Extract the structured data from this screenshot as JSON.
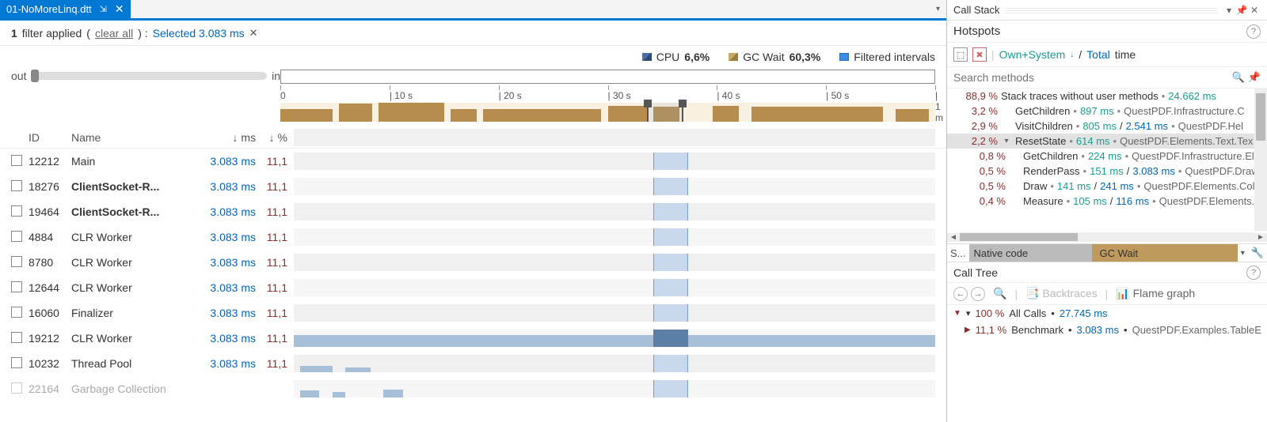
{
  "tab": {
    "title": "01-NoMoreLinq.dtt"
  },
  "filter": {
    "count": "1",
    "applied_text": "filter applied",
    "clear": "clear all",
    "selected": "Selected 3.083 ms"
  },
  "metrics": {
    "cpu_label": "CPU",
    "cpu_value": "6,6%",
    "gc_label": "GC Wait",
    "gc_value": "60,3%",
    "filtered_label": "Filtered intervals"
  },
  "zoom": {
    "out": "out",
    "in": "in"
  },
  "ruler": [
    "0",
    "10 s",
    "20 s",
    "30 s",
    "40 s",
    "50 s",
    "1 m"
  ],
  "thread_header": {
    "id": "ID",
    "name": "Name",
    "ms": "↓ ms",
    "pct": "↓ %"
  },
  "threads": [
    {
      "id": "12212",
      "name": "Main",
      "ms": "3.083 ms",
      "pct": "11,1",
      "bold": false
    },
    {
      "id": "18276",
      "name": "ClientSocket-R...",
      "ms": "3.083 ms",
      "pct": "11,1",
      "bold": true
    },
    {
      "id": "19464",
      "name": "ClientSocket-R...",
      "ms": "3.083 ms",
      "pct": "11,1",
      "bold": true
    },
    {
      "id": "4884",
      "name": "CLR Worker",
      "ms": "3.083 ms",
      "pct": "11,1",
      "bold": false
    },
    {
      "id": "8780",
      "name": "CLR Worker",
      "ms": "3.083 ms",
      "pct": "11,1",
      "bold": false
    },
    {
      "id": "12644",
      "name": "CLR Worker",
      "ms": "3.083 ms",
      "pct": "11,1",
      "bold": false
    },
    {
      "id": "16060",
      "name": "Finalizer",
      "ms": "3.083 ms",
      "pct": "11,1",
      "bold": false
    },
    {
      "id": "19212",
      "name": "CLR Worker",
      "ms": "3.083 ms",
      "pct": "11,1",
      "bold": false,
      "heavy": true
    },
    {
      "id": "10232",
      "name": "Thread Pool",
      "ms": "3.083 ms",
      "pct": "11,1",
      "bold": false
    },
    {
      "id": "22164",
      "name": "Garbage Collection",
      "ms": "",
      "pct": "",
      "bold": false,
      "dim": true
    }
  ],
  "selection": {
    "left_pct": 56.0,
    "width_pct": 5.5
  },
  "callstack": {
    "title": "Call Stack",
    "hotspots_title": "Hotspots",
    "own_system": "Own+System",
    "total": "Total",
    "time": "time",
    "search_placeholder": "Search methods"
  },
  "hotspots": [
    {
      "pct": "88,9 %",
      "name": "Stack traces without user methods",
      "own": "24.662 ms",
      "tot": "",
      "ns": "",
      "top": true
    },
    {
      "pct": "3,2 %",
      "name": "GetChildren",
      "own": "897 ms",
      "tot": "",
      "ns": "QuestPDF.Infrastructure.C"
    },
    {
      "pct": "2,9 %",
      "name": "VisitChildren",
      "own": "805 ms",
      "tot": "2.541 ms",
      "ns": "QuestPDF.Hel"
    },
    {
      "pct": "2,2 %",
      "name": "ResetState",
      "own": "614 ms",
      "tot": "",
      "ns": "QuestPDF.Elements.Text.Tex",
      "sel": true,
      "exp": true
    },
    {
      "pct": "0,8 %",
      "name": "GetChildren",
      "own": "224 ms",
      "tot": "",
      "ns": "QuestPDF.Infrastructure.El",
      "child": true
    },
    {
      "pct": "0,5 %",
      "name": "RenderPass",
      "own": "151 ms",
      "tot": "3.083 ms",
      "ns": "QuestPDF.Drawi",
      "child": true
    },
    {
      "pct": "0,5 %",
      "name": "Draw",
      "own": "141 ms",
      "tot": "241 ms",
      "ns": "QuestPDF.Elements.Colu",
      "child": true
    },
    {
      "pct": "0,4 %",
      "name": "Measure",
      "own": "105 ms",
      "tot": "116 ms",
      "ns": "QuestPDF.Elements.",
      "child": true
    }
  ],
  "summary": {
    "s": "S...",
    "native": "Native code",
    "gc": "GC Wait"
  },
  "calltree": {
    "title": "Call Tree",
    "backtraces": "Backtraces",
    "flame": "Flame graph",
    "rows": [
      {
        "pct": "100 %",
        "name": "All Calls",
        "ms": "27.745 ms",
        "ns": "",
        "root": true
      },
      {
        "pct": "11,1 %",
        "name": "Benchmark",
        "ms": "3.083 ms",
        "ns": "QuestPDF.Examples.TableE"
      }
    ]
  }
}
